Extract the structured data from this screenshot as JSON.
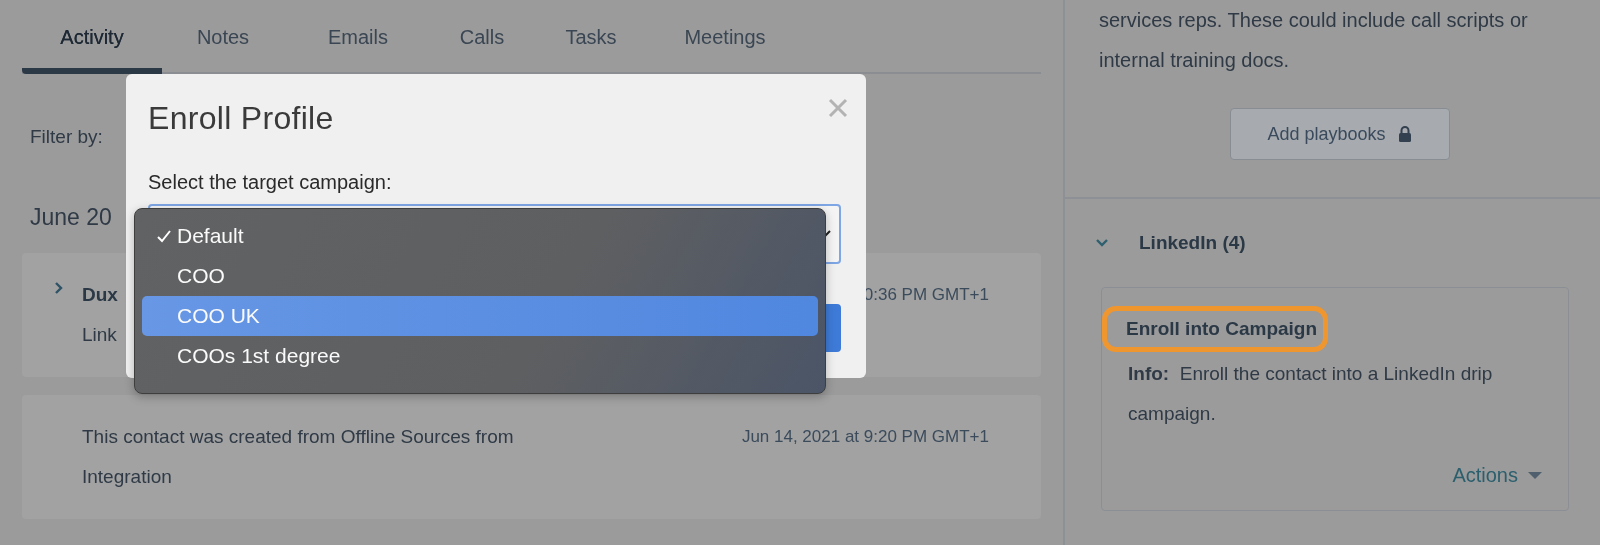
{
  "tabs": [
    {
      "label": "Activity",
      "selected": true
    },
    {
      "label": "Notes",
      "selected": false
    },
    {
      "label": "Emails",
      "selected": false
    },
    {
      "label": "Calls",
      "selected": false
    },
    {
      "label": "Tasks",
      "selected": false
    },
    {
      "label": "Meetings",
      "selected": false
    }
  ],
  "filter_label": "Filter by:",
  "date_heading": "June 20",
  "activities": [
    {
      "kind": "expandable",
      "expanded": false,
      "title": "Dux",
      "timestamp": "0:36 PM GMT+1",
      "body": "Link"
    },
    {
      "kind": "plain",
      "body": "This contact was created from Offline Sources from Integration",
      "timestamp": "Jun 14, 2021 at 9:20 PM GMT+1"
    }
  ],
  "sidebar": {
    "playbooks_text": "services reps. These could include call scripts or internal training docs.",
    "playbooks_button": {
      "label": "Add playbooks",
      "locked": true
    },
    "section": {
      "title": "LinkedIn (4)",
      "expanded": true,
      "action": {
        "title": "Enroll into Campaign",
        "highlighted": true,
        "info": "**Info:**  Enroll the contact into a LinkedIn drip campaign.",
        "menu": "Actions"
      }
    }
  },
  "modal": {
    "title": "Enroll Profile",
    "field_label": "Select the target campaign:",
    "options": [
      {
        "label": "Default",
        "selected": true,
        "highlighted": false
      },
      {
        "label": "COO",
        "selected": false,
        "highlighted": false
      },
      {
        "label": "COO UK",
        "selected": false,
        "highlighted": true
      },
      {
        "label": "COOs 1st degree",
        "selected": false,
        "highlighted": false
      }
    ]
  }
}
